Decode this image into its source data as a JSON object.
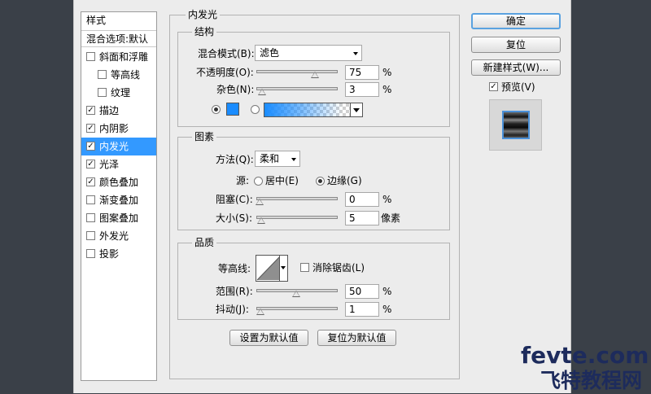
{
  "sidebar": {
    "header_styles": "样式",
    "header_blend": "混合选项:默认",
    "items": [
      {
        "label": "斜面和浮雕",
        "checked": false,
        "indent": false,
        "selected": false
      },
      {
        "label": "等高线",
        "checked": false,
        "indent": true,
        "selected": false
      },
      {
        "label": "纹理",
        "checked": false,
        "indent": true,
        "selected": false
      },
      {
        "label": "描边",
        "checked": true,
        "indent": false,
        "selected": false
      },
      {
        "label": "内阴影",
        "checked": true,
        "indent": false,
        "selected": false
      },
      {
        "label": "内发光",
        "checked": true,
        "indent": false,
        "selected": true
      },
      {
        "label": "光泽",
        "checked": true,
        "indent": false,
        "selected": false
      },
      {
        "label": "颜色叠加",
        "checked": true,
        "indent": false,
        "selected": false
      },
      {
        "label": "渐变叠加",
        "checked": false,
        "indent": false,
        "selected": false
      },
      {
        "label": "图案叠加",
        "checked": false,
        "indent": false,
        "selected": false
      },
      {
        "label": "外发光",
        "checked": false,
        "indent": false,
        "selected": false
      },
      {
        "label": "投影",
        "checked": false,
        "indent": false,
        "selected": false
      }
    ]
  },
  "panel": {
    "title": "内发光",
    "structure": {
      "title": "结构",
      "blend_mode_label": "混合模式(B):",
      "blend_mode_value": "滤色",
      "opacity_label": "不透明度(O):",
      "opacity_value": "75",
      "opacity_fraction": 0.75,
      "noise_label": "杂色(N):",
      "noise_value": "3",
      "noise_fraction": 0.03,
      "unit": "%",
      "glow_color": "#1a8cff"
    },
    "elements": {
      "title": "图素",
      "technique_label": "方法(Q):",
      "technique_value": "柔和",
      "source_label": "源:",
      "source_center": "居中(E)",
      "source_edge": "边缘(G)",
      "choke_label": "阻塞(C):",
      "choke_value": "0",
      "choke_fraction": 0,
      "size_label": "大小(S):",
      "size_value": "5",
      "size_fraction": 0.02,
      "size_unit": "像素",
      "unit": "%"
    },
    "quality": {
      "title": "品质",
      "contour_label": "等高线:",
      "antialias_label": "消除锯齿(L)",
      "range_label": "范围(R):",
      "range_value": "50",
      "range_fraction": 0.5,
      "jitter_label": "抖动(J):",
      "jitter_value": "1",
      "jitter_fraction": 0.01,
      "unit": "%"
    },
    "make_default_label": "设置为默认值",
    "reset_default_label": "复位为默认值"
  },
  "actions": {
    "ok_label": "确定",
    "reset_label": "复位",
    "new_style_label": "新建样式(W)...",
    "preview_label": "预览(V)",
    "preview_checked": true
  },
  "watermark": {
    "line1": "fevte.com",
    "line2": "飞特教程网"
  }
}
